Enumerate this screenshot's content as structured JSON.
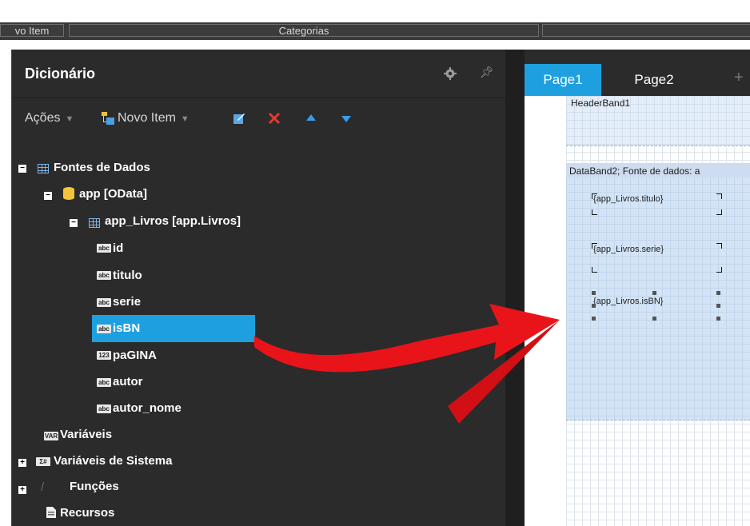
{
  "toolbar": {
    "item_fragment": "vo Item",
    "categories": "Categorias"
  },
  "panel": {
    "title": "Dicionário",
    "actions_label": "Ações",
    "new_item_label": "Novo Item"
  },
  "tree": {
    "data_sources": "Fontes de Dados",
    "connection": "app [OData]",
    "table": "app_Livros [app.Livros]",
    "columns": [
      {
        "label": "id",
        "type": "abc"
      },
      {
        "label": "titulo",
        "type": "abc"
      },
      {
        "label": "serie",
        "type": "abc"
      },
      {
        "label": "isBN",
        "type": "abc"
      },
      {
        "label": "paGINA",
        "type": "123"
      },
      {
        "label": "autor",
        "type": "abc"
      },
      {
        "label": "autor_nome",
        "type": "abc"
      }
    ],
    "variables": "Variáveis",
    "variables_icon": "VAR",
    "system_variables": "Variáveis de Sistema",
    "system_variables_icon": "Σ#",
    "functions": "Funções",
    "resources": "Recursos"
  },
  "designer": {
    "tabs": [
      "Page1",
      "Page2"
    ],
    "header_band": "HeaderBand1",
    "data_band": "DataBand2; Fonte de dados: a",
    "fields": [
      "{app_Livros.titulo}",
      "{app_Livros.serie}",
      "{app_Livros.isBN}"
    ]
  },
  "colors": {
    "accent": "#1ea0e0",
    "arrow": "#e8141a",
    "panel_bg": "#2b2b2b"
  }
}
